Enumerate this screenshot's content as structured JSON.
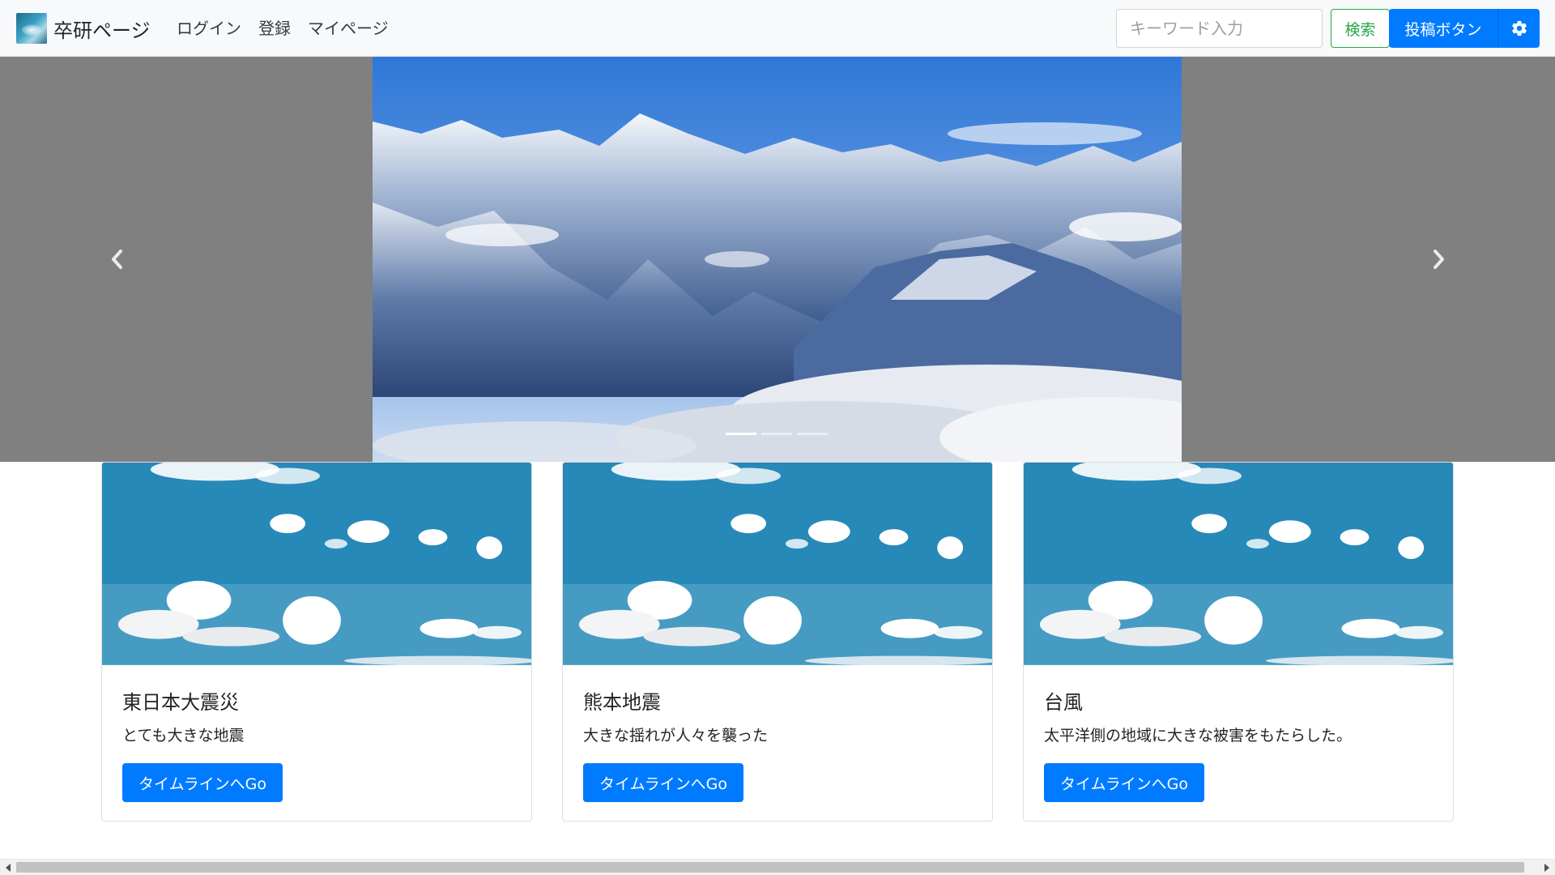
{
  "brand": {
    "text": "卒研ページ"
  },
  "nav": [
    {
      "label": "ログイン"
    },
    {
      "label": "登録"
    },
    {
      "label": "マイページ"
    }
  ],
  "search": {
    "placeholder": "キーワード入力",
    "button_label": "検索"
  },
  "post_button_label": "投稿ボタン",
  "icons": {
    "gear": "gear-icon",
    "carousel_prev": "chevron-left-icon",
    "carousel_next": "chevron-right-icon"
  },
  "carousel": {
    "slides": 3,
    "active_slide": 1
  },
  "cards": [
    {
      "title": "東日本大震災",
      "text": "とても大きな地震",
      "button_label": "タイムラインへGo"
    },
    {
      "title": "熊本地震",
      "text": "大きな揺れが人々を襲った",
      "button_label": "タイムラインへGo"
    },
    {
      "title": "台風",
      "text": "太平洋側の地域に大きな被害をもたらした。",
      "button_label": "タイムラインへGo"
    }
  ],
  "colors": {
    "primary": "#007bff",
    "success": "#28a745",
    "navbar_bg": "#f8f9fa",
    "carousel_bg": "#808080"
  }
}
